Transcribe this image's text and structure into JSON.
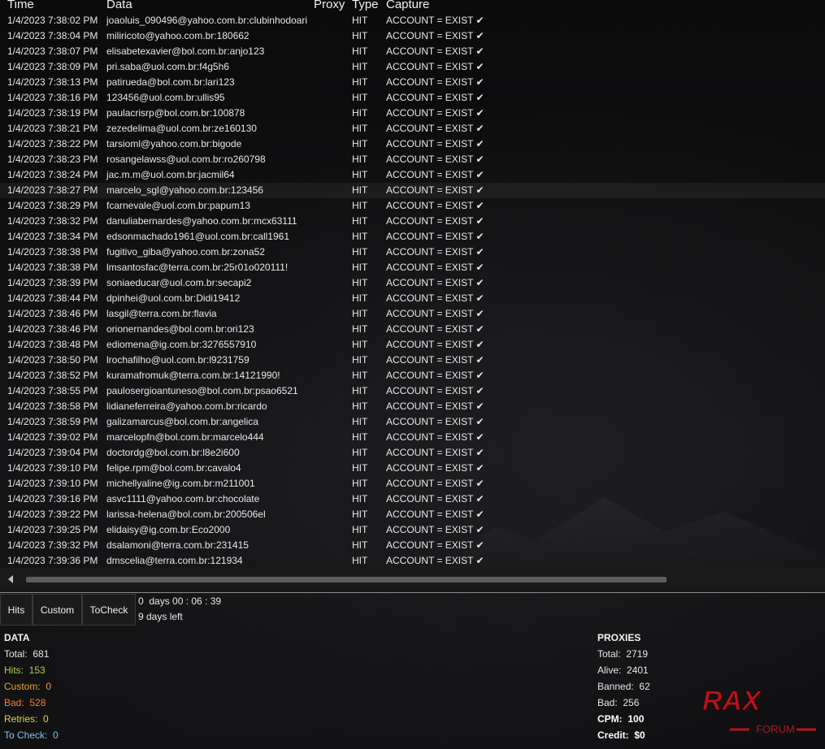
{
  "columns": {
    "time": "Time",
    "data": "Data",
    "proxy": "Proxy",
    "type": "Type",
    "capture": "Capture"
  },
  "rows": [
    {
      "time": "1/4/2023 7:38:02 PM",
      "data": "joaoluis_090496@yahoo.com.br:clubinhodoari",
      "type": "HIT",
      "capture": "ACCOUNT = EXIST"
    },
    {
      "time": "1/4/2023 7:38:04 PM",
      "data": "miliricoto@yahoo.com.br:180662",
      "type": "HIT",
      "capture": "ACCOUNT = EXIST"
    },
    {
      "time": "1/4/2023 7:38:07 PM",
      "data": "elisabetexavier@bol.com.br:anjo123",
      "type": "HIT",
      "capture": "ACCOUNT = EXIST"
    },
    {
      "time": "1/4/2023 7:38:09 PM",
      "data": "pri.saba@uol.com.br:f4g5h6",
      "type": "HIT",
      "capture": "ACCOUNT = EXIST"
    },
    {
      "time": "1/4/2023 7:38:13 PM",
      "data": "patirueda@bol.com.br:lari123",
      "type": "HIT",
      "capture": "ACCOUNT = EXIST"
    },
    {
      "time": "1/4/2023 7:38:16 PM",
      "data": "123456@uol.com.br:ullis95",
      "type": "HIT",
      "capture": "ACCOUNT = EXIST"
    },
    {
      "time": "1/4/2023 7:38:19 PM",
      "data": "paulacrisrp@bol.com.br:100878",
      "type": "HIT",
      "capture": "ACCOUNT = EXIST"
    },
    {
      "time": "1/4/2023 7:38:21 PM",
      "data": "zezedelima@uol.com.br:ze160130",
      "type": "HIT",
      "capture": "ACCOUNT = EXIST"
    },
    {
      "time": "1/4/2023 7:38:22 PM",
      "data": "tarsioml@yahoo.com.br:bigode",
      "type": "HIT",
      "capture": "ACCOUNT = EXIST"
    },
    {
      "time": "1/4/2023 7:38:23 PM",
      "data": "rosangelawss@uol.com.br:ro260798",
      "type": "HIT",
      "capture": "ACCOUNT = EXIST"
    },
    {
      "time": "1/4/2023 7:38:24 PM",
      "data": "jac.m.m@uol.com.br:jacmil64",
      "type": "HIT",
      "capture": "ACCOUNT = EXIST"
    },
    {
      "time": "1/4/2023 7:38:27 PM",
      "data": "marcelo_sgl@yahoo.com.br:123456",
      "type": "HIT",
      "capture": "ACCOUNT = EXIST"
    },
    {
      "time": "1/4/2023 7:38:29 PM",
      "data": "fcarnevale@uol.com.br:papum13",
      "type": "HIT",
      "capture": "ACCOUNT = EXIST"
    },
    {
      "time": "1/4/2023 7:38:32 PM",
      "data": "danuliabernardes@yahoo.com.br:mcx63111",
      "type": "HIT",
      "capture": "ACCOUNT = EXIST"
    },
    {
      "time": "1/4/2023 7:38:34 PM",
      "data": "edsonmachado1961@uol.com.br:call1961",
      "type": "HIT",
      "capture": "ACCOUNT = EXIST"
    },
    {
      "time": "1/4/2023 7:38:38 PM",
      "data": "fugitivo_giba@yahoo.com.br:zona52",
      "type": "HIT",
      "capture": "ACCOUNT = EXIST"
    },
    {
      "time": "1/4/2023 7:38:38 PM",
      "data": "lmsantosfac@terra.com.br:25r01o020111!",
      "type": "HIT",
      "capture": "ACCOUNT = EXIST"
    },
    {
      "time": "1/4/2023 7:38:39 PM",
      "data": "soniaeducar@uol.com.br:secapi2",
      "type": "HIT",
      "capture": "ACCOUNT = EXIST"
    },
    {
      "time": "1/4/2023 7:38:44 PM",
      "data": "dpinhei@uol.com.br:Didi19412",
      "type": "HIT",
      "capture": "ACCOUNT = EXIST"
    },
    {
      "time": "1/4/2023 7:38:46 PM",
      "data": "lasgil@terra.com.br:flavia",
      "type": "HIT",
      "capture": "ACCOUNT = EXIST"
    },
    {
      "time": "1/4/2023 7:38:46 PM",
      "data": "orionernandes@bol.com.br:ori123",
      "type": "HIT",
      "capture": "ACCOUNT = EXIST"
    },
    {
      "time": "1/4/2023 7:38:48 PM",
      "data": "ediomena@ig.com.br:3276557910",
      "type": "HIT",
      "capture": "ACCOUNT = EXIST"
    },
    {
      "time": "1/4/2023 7:38:50 PM",
      "data": "lrochafilho@uol.com.br:l9231759",
      "type": "HIT",
      "capture": "ACCOUNT = EXIST"
    },
    {
      "time": "1/4/2023 7:38:52 PM",
      "data": "kuramafromuk@terra.com.br:14121990!",
      "type": "HIT",
      "capture": "ACCOUNT = EXIST"
    },
    {
      "time": "1/4/2023 7:38:55 PM",
      "data": "paulosergioantuneso@bol.com.br:psao6521",
      "type": "HIT",
      "capture": "ACCOUNT = EXIST"
    },
    {
      "time": "1/4/2023 7:38:58 PM",
      "data": "lidianeferreira@yahoo.com.br:ricardo",
      "type": "HIT",
      "capture": "ACCOUNT = EXIST"
    },
    {
      "time": "1/4/2023 7:38:59 PM",
      "data": "galizamarcus@bol.com.br:angelica",
      "type": "HIT",
      "capture": "ACCOUNT = EXIST"
    },
    {
      "time": "1/4/2023 7:39:02 PM",
      "data": "marcelopfn@bol.com.br:marcelo444",
      "type": "HIT",
      "capture": "ACCOUNT = EXIST"
    },
    {
      "time": "1/4/2023 7:39:04 PM",
      "data": "doctordg@bol.com.br:l8e2i600",
      "type": "HIT",
      "capture": "ACCOUNT = EXIST"
    },
    {
      "time": "1/4/2023 7:39:10 PM",
      "data": "felipe.rpm@bol.com.br:cavalo4",
      "type": "HIT",
      "capture": "ACCOUNT = EXIST"
    },
    {
      "time": "1/4/2023 7:39:10 PM",
      "data": "michellyaline@ig.com.br:m211001",
      "type": "HIT",
      "capture": "ACCOUNT = EXIST"
    },
    {
      "time": "1/4/2023 7:39:16 PM",
      "data": "asvc1111@yahoo.com.br:chocolate",
      "type": "HIT",
      "capture": "ACCOUNT = EXIST"
    },
    {
      "time": "1/4/2023 7:39:22 PM",
      "data": "larissa-helena@bol.com.br:200506el",
      "type": "HIT",
      "capture": "ACCOUNT = EXIST"
    },
    {
      "time": "1/4/2023 7:39:25 PM",
      "data": "elidaisy@ig.com.br:Eco2000",
      "type": "HIT",
      "capture": "ACCOUNT = EXIST"
    },
    {
      "time": "1/4/2023 7:39:32 PM",
      "data": "dsalamoni@terra.com.br:231415",
      "type": "HIT",
      "capture": "ACCOUNT = EXIST"
    },
    {
      "time": "1/4/2023 7:39:36 PM",
      "data": "dmscelia@terra.com.br:121934",
      "type": "HIT",
      "capture": "ACCOUNT = EXIST"
    }
  ],
  "selected_row": 11,
  "tabs": {
    "hits": "Hits",
    "custom": "Custom",
    "tocheck": "ToCheck"
  },
  "timer": {
    "elapsed": "0  days 00 : 06 : 39",
    "days_left": "9 days left"
  },
  "data_stats": {
    "title": "DATA",
    "total_label": "Total:",
    "total": "681",
    "hits_label": "Hits:",
    "hits": "153",
    "custom_label": "Custom:",
    "custom": "0",
    "bad_label": "Bad:",
    "bad": "528",
    "retries_label": "Retries:",
    "retries": "0",
    "tocheck_label": "To Check:",
    "tocheck": "0"
  },
  "proxy_stats": {
    "title": "PROXIES",
    "total_label": "Total:",
    "total": "2719",
    "alive_label": "Alive:",
    "alive": "2401",
    "banned_label": "Banned:",
    "banned": "62",
    "bad_label": "Bad:",
    "bad": "256",
    "cpm_label": "CPM:",
    "cpm": "100",
    "credit_label": "Credit:",
    "credit": "$0"
  },
  "logo": {
    "text": "RAX",
    "sub": "FORUM",
    "color": "#b5141a"
  },
  "colors": {
    "hits": "#a8d04b",
    "custom": "#f0a030",
    "bad": "#ff7a33",
    "retries": "#e6d24a",
    "tocheck": "#7ec3e6"
  }
}
